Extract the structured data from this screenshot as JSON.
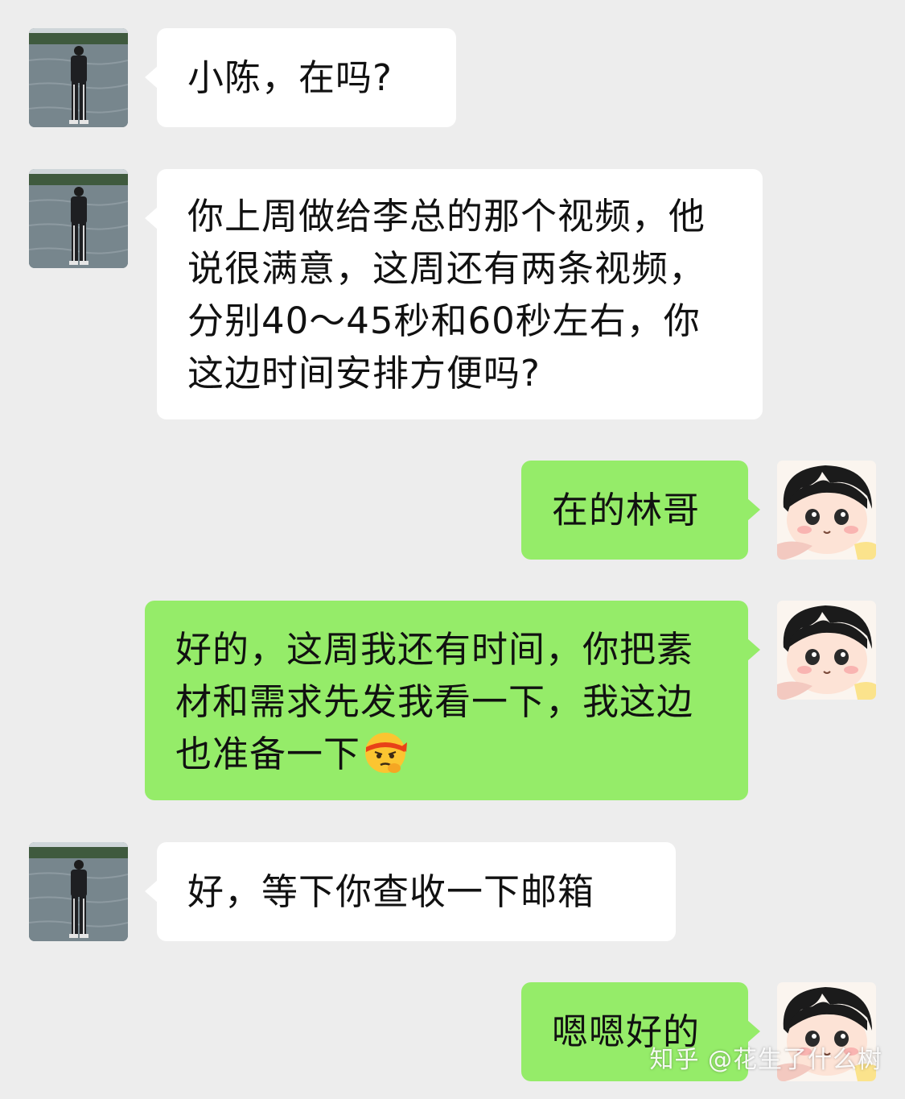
{
  "messages": [
    {
      "side": "incoming",
      "sender": "contact",
      "text": "小陈，在吗?"
    },
    {
      "side": "incoming",
      "sender": "contact",
      "text": "你上周做给李总的那个视频，他说很满意，这周还有两条视频，分别40～45秒和60秒左右，你这边时间安排方便吗?"
    },
    {
      "side": "outgoing",
      "sender": "me",
      "text": "在的林哥"
    },
    {
      "side": "outgoing",
      "sender": "me",
      "text": "好的，这周我还有时间，你把素材和需求先发我看一下，我这边也准备一下",
      "emoji": "determined-headband-emoji"
    },
    {
      "side": "incoming",
      "sender": "contact",
      "text": "好，等下你查收一下邮箱"
    },
    {
      "side": "outgoing",
      "sender": "me",
      "text": "嗯嗯好的"
    }
  ],
  "watermark": "知乎 @花生了什么树",
  "colors": {
    "background": "#ededed",
    "incoming_bubble": "#ffffff",
    "outgoing_bubble": "#95ec69",
    "text": "#111111"
  },
  "icons": {
    "contact_avatar": "man-by-river-avatar-icon",
    "my_avatar": "cartoon-boy-avatar-icon"
  }
}
